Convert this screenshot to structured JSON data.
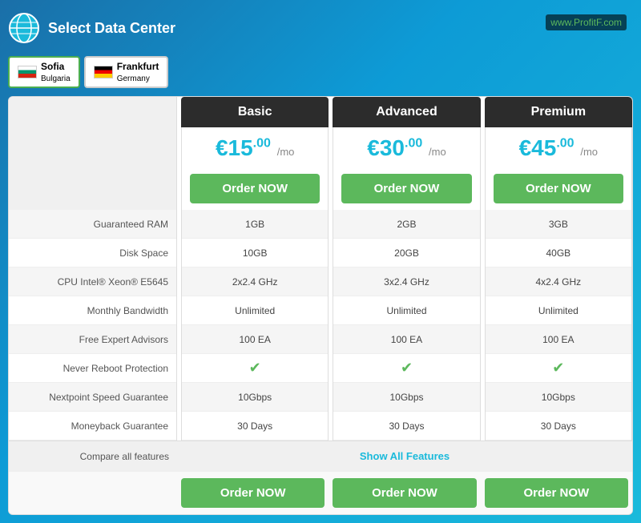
{
  "header": {
    "select_data_center": "Select Data Center",
    "globe_icon": "🌍"
  },
  "dc_options": [
    {
      "id": "sofia",
      "flag": "bg",
      "city": "Sofia",
      "country": "Bulgaria",
      "active": true
    },
    {
      "id": "frankfurt",
      "flag": "de",
      "city": "Frankfurt",
      "country": "Germany",
      "active": false
    }
  ],
  "plans": [
    {
      "id": "basic",
      "name": "Basic",
      "price_currency": "€",
      "price_whole": "15",
      "price_decimal": ".00",
      "price_period": "/mo",
      "order_label": "Order NOW"
    },
    {
      "id": "advanced",
      "name": "Advanced",
      "price_currency": "€",
      "price_whole": "30",
      "price_decimal": ".00",
      "price_period": "/mo",
      "order_label": "Order NOW"
    },
    {
      "id": "premium",
      "name": "Premium",
      "price_currency": "€",
      "price_whole": "45",
      "price_decimal": ".00",
      "price_period": "/mo",
      "order_label": "Order NOW"
    }
  ],
  "features": [
    {
      "label": "Guaranteed RAM",
      "values": [
        "1GB",
        "2GB",
        "3GB"
      ]
    },
    {
      "label": "Disk Space",
      "values": [
        "10GB",
        "20GB",
        "40GB"
      ]
    },
    {
      "label": "CPU Intel® Xeon® E5645",
      "values": [
        "2x2.4 GHz",
        "3x2.4 GHz",
        "4x2.4 GHz"
      ]
    },
    {
      "label": "Monthly Bandwidth",
      "values": [
        "Unlimited",
        "Unlimited",
        "Unlimited"
      ]
    },
    {
      "label": "Free Expert Advisors",
      "values": [
        "100 EA",
        "100 EA",
        "100 EA"
      ]
    },
    {
      "label": "Never Reboot Protection",
      "values": [
        "check",
        "check",
        "check"
      ]
    },
    {
      "label": "Nextpoint Speed Guarantee",
      "values": [
        "10Gbps",
        "10Gbps",
        "10Gbps"
      ]
    },
    {
      "label": "Moneyback Guarantee",
      "values": [
        "30 Days",
        "30 Days",
        "30 Days"
      ]
    }
  ],
  "compare": {
    "label": "Compare all features",
    "link_text": "Show All Features"
  },
  "watermark": {
    "text": "www.Profit",
    "highlight": "F",
    "suffix": ".com"
  }
}
